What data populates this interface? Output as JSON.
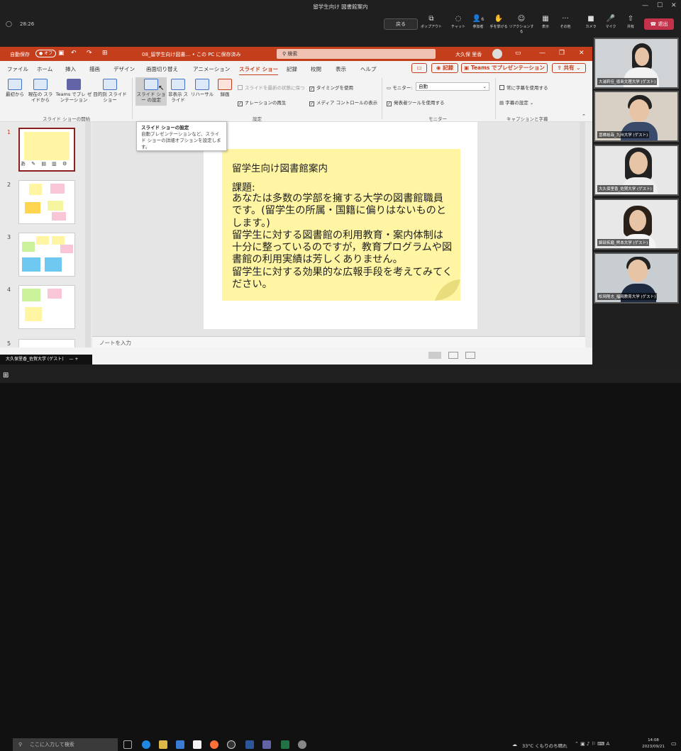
{
  "window": {
    "title": "留学生向け 図書館案内"
  },
  "meeting": {
    "time": "28:26",
    "back_label": "戻る",
    "leave_label": "退出",
    "tools": [
      {
        "label": "ポップアウト",
        "icon": "popout-icon"
      },
      {
        "label": "チャット",
        "icon": "chat-icon"
      },
      {
        "label": "参加者",
        "icon": "people-icon",
        "count": "6"
      },
      {
        "label": "手を挙げる",
        "icon": "hand-icon"
      },
      {
        "label": "リアクションする",
        "icon": "reaction-icon"
      },
      {
        "label": "表示",
        "icon": "view-icon"
      },
      {
        "label": "その他",
        "icon": "more-icon"
      },
      {
        "label": "カメラ",
        "icon": "camera-icon"
      },
      {
        "label": "マイク",
        "icon": "mic-icon"
      },
      {
        "label": "共有",
        "icon": "share-icon"
      }
    ]
  },
  "ppt": {
    "autosave": "自動保存",
    "autosave_state": "オフ",
    "filename": "08_留学生向け図書…  •  この PC に保存済み",
    "search_placeholder": "検索",
    "user": "大久保 里香",
    "tabs": [
      "ファイル",
      "ホーム",
      "挿入",
      "描画",
      "デザイン",
      "画面切り替え",
      "アニメーション",
      "スライド ショー",
      "記録",
      "校閲",
      "表示",
      "ヘルプ"
    ],
    "record_label": "記録",
    "teams_label": "Teams でプレゼンテーション",
    "share_label": "共有",
    "ribbon": {
      "btn_from_start": "最初から",
      "btn_from_current": "現在の スライドから",
      "btn_teams": "Teams でプレ ゼンテーション",
      "btn_custom": "目的別 スライド ショー",
      "group_start": "スライド ショーの開始",
      "btn_setup": "スライド ショー の設定",
      "btn_hide": "非表示 スライド",
      "btn_rehearse": "リハーサル",
      "btn_record": "録画",
      "chk_update": "スライドを最新の状態に保つ",
      "chk_timing": "タイミングを使用",
      "chk_narration": "ナレーションの再生",
      "chk_media": "メディア コントロールの表示",
      "group_setup": "設定",
      "monitor_label": "モニター:",
      "monitor_value": "自動",
      "chk_presenter": "発表者ツールを使用する",
      "group_monitor": "モニター",
      "chk_captions": "常に字幕を使用する",
      "captions_setting": "字幕の設定",
      "group_captions": "キャプションと字幕"
    },
    "tooltip": {
      "title": "スライド ショーの設定",
      "body": "自動プレゼンテーションなど、スライド ショーの詳細オプションを設定します。"
    },
    "slide": {
      "heading": "留学生向け図書館案内",
      "label": "課題:",
      "body": "あなたは多数の学部を擁する大学の図書館職員です。(留学生の所属・国籍に偏りはないものとします。)\n留学生に対する図書館の利用教育・案内体制は十分に整っているのですが，教育プログラムや図書館の利用実績は芳しくありません。\n留学生に対する効果的な広報手段を考えてみてください。"
    },
    "thumb_numbers": [
      "1",
      "2",
      "3",
      "4",
      "5"
    ],
    "notes_placeholder": "ノートを入力"
  },
  "participants": [
    {
      "name": "大浦莉佳_徳島文理大学 (ゲスト)"
    },
    {
      "name": "冨橋裕哉_九州大学 (ゲスト)"
    },
    {
      "name": "大久保里香_佐賀大学 (ゲスト)"
    },
    {
      "name": "錦部拓磨_熊本大学 (ゲスト)"
    },
    {
      "name": "松岡隆志_福岡教育大学 (ゲスト)"
    }
  ],
  "presenter_name": "大久保里香_佐賀大学 (ゲスト)",
  "taskbar": {
    "search_placeholder": "ここに入力して検索",
    "weather": "33°C くもりのち晴れ",
    "time": "14:08",
    "date": "2023/09/21"
  }
}
